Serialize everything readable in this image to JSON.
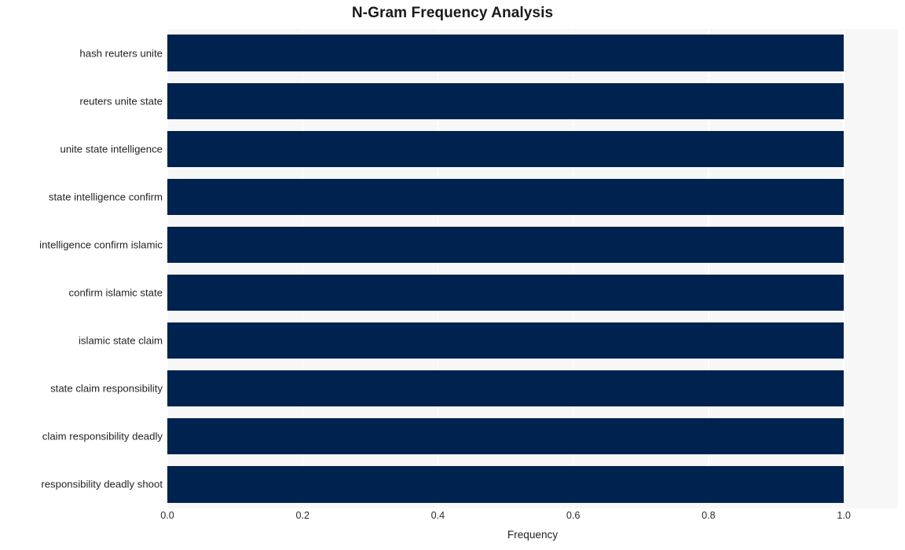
{
  "chart_data": {
    "type": "bar",
    "orientation": "horizontal",
    "title": "N-Gram Frequency Analysis",
    "xlabel": "Frequency",
    "ylabel": "",
    "categories": [
      "hash reuters unite",
      "reuters unite state",
      "unite state intelligence",
      "state intelligence confirm",
      "intelligence confirm islamic",
      "confirm islamic state",
      "islamic state claim",
      "state claim responsibility",
      "claim responsibility deadly",
      "responsibility deadly shoot"
    ],
    "values": [
      1.0,
      1.0,
      1.0,
      1.0,
      1.0,
      1.0,
      1.0,
      1.0,
      1.0,
      1.0
    ],
    "xlim": [
      0.0,
      1.08
    ],
    "xticks": [
      0.0,
      0.2,
      0.4,
      0.6,
      0.8,
      1.0
    ],
    "xtick_labels": [
      "0.0",
      "0.2",
      "0.4",
      "0.6",
      "0.8",
      "1.0"
    ],
    "grid": true,
    "grid_axis": "x",
    "legend": null,
    "bar_color": "#00224F",
    "plot_background": "#F7F7F7",
    "figure_background": "#FFFFFF",
    "gridline_color": "#FFFFFF",
    "text_color": "#232323"
  }
}
